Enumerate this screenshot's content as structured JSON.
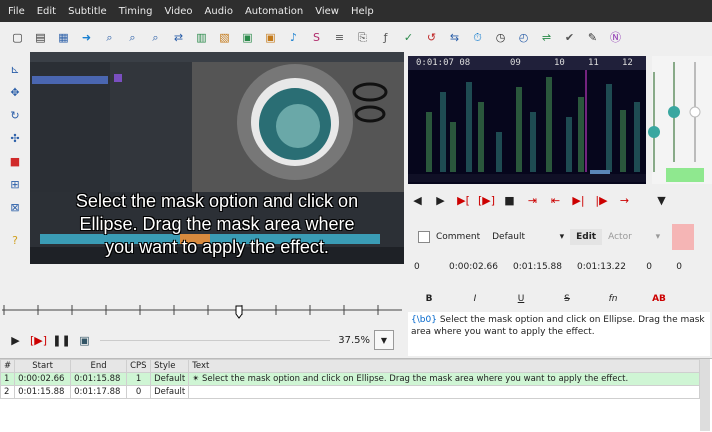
{
  "menu": [
    "File",
    "Edit",
    "Subtitle",
    "Timing",
    "Video",
    "Audio",
    "Automation",
    "View",
    "Help"
  ],
  "toolbar_icons": [
    "new-file-icon",
    "open-file-icon",
    "save-icon",
    "jump-icon",
    "zoom-icon",
    "zoom-out-icon",
    "search-icon",
    "replace-icon",
    "copy-icon",
    "paste-icon",
    "film-icon",
    "film-strip-icon",
    "audio-icon",
    "styles-icon",
    "properties-icon",
    "attachments-icon",
    "fonts-icon",
    "spell-icon",
    "resample-icon",
    "shift-icon",
    "timing-icon",
    "timer-icon",
    "clock-icon",
    "translate-icon",
    "check-icon",
    "tools-icon",
    "script-icon"
  ],
  "left_tools": [
    "select-tool-icon",
    "move-tool-icon",
    "rotate-z-icon",
    "rotate-xy-icon",
    "scale-icon",
    "clip-icon",
    "vector-clip-icon",
    "help-icon"
  ],
  "video": {
    "subtitle_lines": [
      "Select the mask option and click on",
      "Ellipse. Drag the mask area where",
      "you want to apply the effect."
    ],
    "zoom": "37.5%"
  },
  "audio": {
    "time_labels": [
      "0:01:07 08",
      "09",
      "10",
      "11",
      "12"
    ]
  },
  "edit": {
    "comment_label": "Comment",
    "style": "Default",
    "edit_label": "Edit",
    "actor_placeholder": "Actor",
    "layer": "0",
    "start": "0:00:02.66",
    "end": "0:01:15.88",
    "duration": "0:01:13.22",
    "margin_l": "0",
    "margin_r": "0",
    "bold": "B",
    "italic": "I",
    "underline": "U",
    "strike": "S",
    "font": "fn",
    "color": "AB",
    "override_tag": "{\\b0}",
    "text": "Select the mask option and click on Ellipse. Drag the mask area where you want to apply the effect."
  },
  "grid": {
    "headers": [
      "#",
      "Start",
      "End",
      "CPS",
      "Style",
      "Text"
    ],
    "rows": [
      {
        "num": "1",
        "start": "0:00:02.66",
        "end": "0:01:15.88",
        "cps": "1",
        "style": "Default",
        "text": "✴ Select the mask option and click on Ellipse. Drag the mask area where you want to apply the effect."
      },
      {
        "num": "2",
        "start": "0:01:15.88",
        "end": "0:01:17.88",
        "cps": "0",
        "style": "Default",
        "text": ""
      }
    ]
  }
}
